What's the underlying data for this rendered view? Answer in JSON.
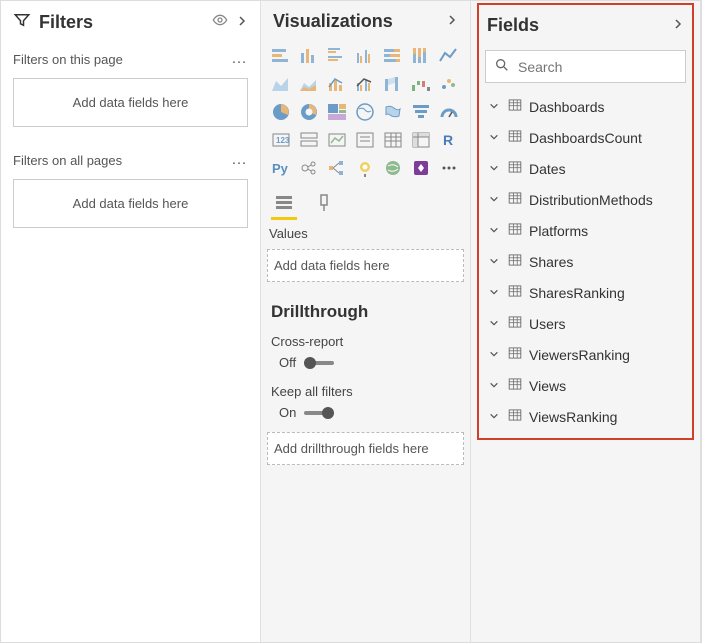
{
  "filters": {
    "title": "Filters",
    "section_page": "Filters on this page",
    "section_all": "Filters on all pages",
    "dropzone_text": "Add data fields here"
  },
  "viz": {
    "title": "Visualizations",
    "values_label": "Values",
    "values_dropzone": "Add data fields here",
    "drillthrough_title": "Drillthrough",
    "cross_report_label": "Cross-report",
    "cross_report_state": "Off",
    "keep_filters_label": "Keep all filters",
    "keep_filters_state": "On",
    "drill_dropzone": "Add drillthrough fields here"
  },
  "fields": {
    "title": "Fields",
    "search_placeholder": "Search",
    "tables": [
      "Dashboards",
      "DashboardsCount",
      "Dates",
      "DistributionMethods",
      "Platforms",
      "Shares",
      "SharesRanking",
      "Users",
      "ViewersRanking",
      "Views",
      "ViewsRanking"
    ]
  }
}
